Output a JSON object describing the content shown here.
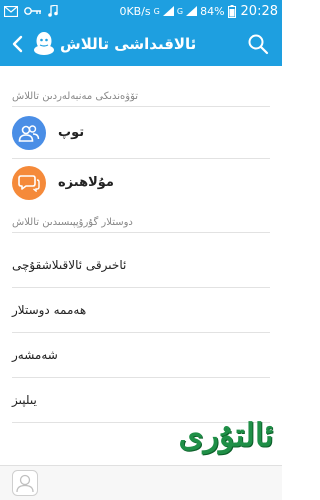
{
  "status_bar": {
    "network_speed": "0KB/s",
    "signal_labels": [
      "G",
      "G"
    ],
    "battery": "84%",
    "time": "20:28"
  },
  "app_bar": {
    "title": "ئالاقىداشى تاللاش",
    "icons": [
      "back-icon",
      "qq-logo-icon",
      "search-icon"
    ]
  },
  "sections": {
    "from_phonebook": {
      "header": "تۆۋەندىكى مەنبەلەردىن تاللاش",
      "items": [
        {
          "label": "توپ",
          "icon": "group-icon",
          "color": "#4a8ee6"
        },
        {
          "label": "مۇلاھىزە",
          "icon": "chat-bubble-icon",
          "color": "#f58a3a"
        }
      ]
    },
    "from_friends": {
      "header": "دوستلار گۇرۇپپىسىدىن تاللاش",
      "items": [
        {
          "label": "ئاخىرقى ئالاقىلاشقۇچى"
        },
        {
          "label": "ھەممە دوستلار"
        },
        {
          "label": "شەمشەر"
        },
        {
          "label": "يىلپىز"
        }
      ]
    }
  },
  "colors": {
    "primary": "#1e9fe0",
    "watermark": "#1f8f47"
  },
  "watermark_text": "ئالتۇرى"
}
